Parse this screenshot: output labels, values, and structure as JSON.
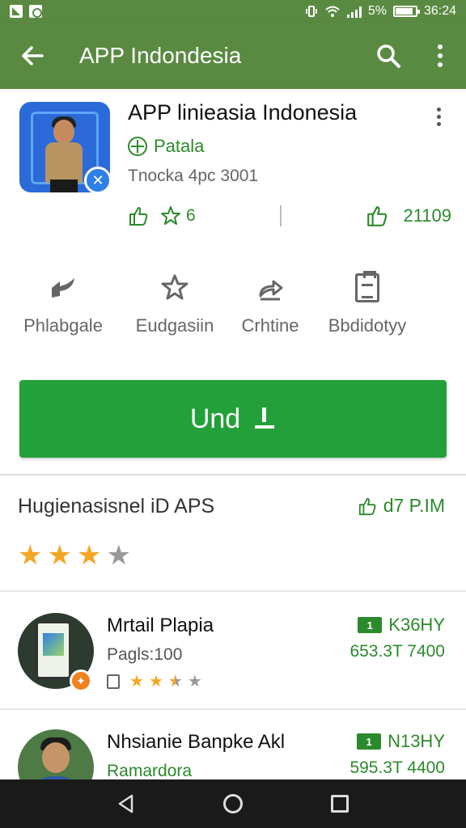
{
  "status_bar": {
    "signal_text": "5%",
    "time": "36:24",
    "battery_level": 0.8
  },
  "toolbar": {
    "title": "APP Indondesia",
    "back_icon": "arrow-back-icon",
    "search_icon": "search-icon",
    "more_icon": "more-vert-icon"
  },
  "app": {
    "title": "APP linieasia Indonesia",
    "developer": "Patala",
    "meta": "Tnocka 4pc 3001",
    "stat_left_value": "6",
    "stat_right_value": "21109",
    "badge_glyph": "✕"
  },
  "actions": [
    {
      "label": "Phlabgale",
      "icon": "share-arrows-icon"
    },
    {
      "label": "Eudgasiin",
      "icon": "star-icon"
    },
    {
      "label": "Crhtine",
      "icon": "reply-arrow-icon"
    },
    {
      "label": "Bbdidotyy",
      "icon": "clipboard-icon"
    }
  ],
  "install": {
    "label": "Und"
  },
  "section": {
    "title": "Hugienasisnel iD APS",
    "link": "d7 P.IM",
    "rating_stars": 3
  },
  "list": [
    {
      "title": "Mrtail Plapia",
      "sub": "Pagls:100",
      "price_tag": "1",
      "price": "K36HY",
      "size": "653.3T 7400",
      "rating": 2.5
    },
    {
      "title": "Nhsianie Banpke Akl",
      "sub": "Ramardora",
      "price_tag": "1",
      "price": "N13HY",
      "size": "595.3T 4400"
    }
  ],
  "colors": {
    "toolbar": "#5a8a42",
    "install": "#23a03a",
    "accent_green": "#2b8a2b",
    "star": "#f5a623"
  }
}
